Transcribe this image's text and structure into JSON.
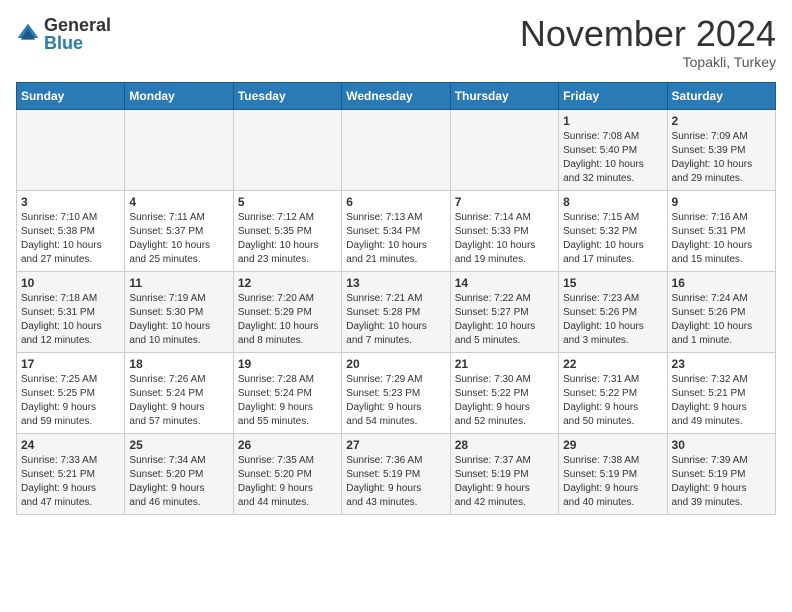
{
  "header": {
    "logo_general": "General",
    "logo_blue": "Blue",
    "month_title": "November 2024",
    "location": "Topakli, Turkey"
  },
  "weekdays": [
    "Sunday",
    "Monday",
    "Tuesday",
    "Wednesday",
    "Thursday",
    "Friday",
    "Saturday"
  ],
  "weeks": [
    [
      {
        "day": "",
        "info": ""
      },
      {
        "day": "",
        "info": ""
      },
      {
        "day": "",
        "info": ""
      },
      {
        "day": "",
        "info": ""
      },
      {
        "day": "",
        "info": ""
      },
      {
        "day": "1",
        "info": "Sunrise: 7:08 AM\nSunset: 5:40 PM\nDaylight: 10 hours\nand 32 minutes."
      },
      {
        "day": "2",
        "info": "Sunrise: 7:09 AM\nSunset: 5:39 PM\nDaylight: 10 hours\nand 29 minutes."
      }
    ],
    [
      {
        "day": "3",
        "info": "Sunrise: 7:10 AM\nSunset: 5:38 PM\nDaylight: 10 hours\nand 27 minutes."
      },
      {
        "day": "4",
        "info": "Sunrise: 7:11 AM\nSunset: 5:37 PM\nDaylight: 10 hours\nand 25 minutes."
      },
      {
        "day": "5",
        "info": "Sunrise: 7:12 AM\nSunset: 5:35 PM\nDaylight: 10 hours\nand 23 minutes."
      },
      {
        "day": "6",
        "info": "Sunrise: 7:13 AM\nSunset: 5:34 PM\nDaylight: 10 hours\nand 21 minutes."
      },
      {
        "day": "7",
        "info": "Sunrise: 7:14 AM\nSunset: 5:33 PM\nDaylight: 10 hours\nand 19 minutes."
      },
      {
        "day": "8",
        "info": "Sunrise: 7:15 AM\nSunset: 5:32 PM\nDaylight: 10 hours\nand 17 minutes."
      },
      {
        "day": "9",
        "info": "Sunrise: 7:16 AM\nSunset: 5:31 PM\nDaylight: 10 hours\nand 15 minutes."
      }
    ],
    [
      {
        "day": "10",
        "info": "Sunrise: 7:18 AM\nSunset: 5:31 PM\nDaylight: 10 hours\nand 12 minutes."
      },
      {
        "day": "11",
        "info": "Sunrise: 7:19 AM\nSunset: 5:30 PM\nDaylight: 10 hours\nand 10 minutes."
      },
      {
        "day": "12",
        "info": "Sunrise: 7:20 AM\nSunset: 5:29 PM\nDaylight: 10 hours\nand 8 minutes."
      },
      {
        "day": "13",
        "info": "Sunrise: 7:21 AM\nSunset: 5:28 PM\nDaylight: 10 hours\nand 7 minutes."
      },
      {
        "day": "14",
        "info": "Sunrise: 7:22 AM\nSunset: 5:27 PM\nDaylight: 10 hours\nand 5 minutes."
      },
      {
        "day": "15",
        "info": "Sunrise: 7:23 AM\nSunset: 5:26 PM\nDaylight: 10 hours\nand 3 minutes."
      },
      {
        "day": "16",
        "info": "Sunrise: 7:24 AM\nSunset: 5:26 PM\nDaylight: 10 hours\nand 1 minute."
      }
    ],
    [
      {
        "day": "17",
        "info": "Sunrise: 7:25 AM\nSunset: 5:25 PM\nDaylight: 9 hours\nand 59 minutes."
      },
      {
        "day": "18",
        "info": "Sunrise: 7:26 AM\nSunset: 5:24 PM\nDaylight: 9 hours\nand 57 minutes."
      },
      {
        "day": "19",
        "info": "Sunrise: 7:28 AM\nSunset: 5:24 PM\nDaylight: 9 hours\nand 55 minutes."
      },
      {
        "day": "20",
        "info": "Sunrise: 7:29 AM\nSunset: 5:23 PM\nDaylight: 9 hours\nand 54 minutes."
      },
      {
        "day": "21",
        "info": "Sunrise: 7:30 AM\nSunset: 5:22 PM\nDaylight: 9 hours\nand 52 minutes."
      },
      {
        "day": "22",
        "info": "Sunrise: 7:31 AM\nSunset: 5:22 PM\nDaylight: 9 hours\nand 50 minutes."
      },
      {
        "day": "23",
        "info": "Sunrise: 7:32 AM\nSunset: 5:21 PM\nDaylight: 9 hours\nand 49 minutes."
      }
    ],
    [
      {
        "day": "24",
        "info": "Sunrise: 7:33 AM\nSunset: 5:21 PM\nDaylight: 9 hours\nand 47 minutes."
      },
      {
        "day": "25",
        "info": "Sunrise: 7:34 AM\nSunset: 5:20 PM\nDaylight: 9 hours\nand 46 minutes."
      },
      {
        "day": "26",
        "info": "Sunrise: 7:35 AM\nSunset: 5:20 PM\nDaylight: 9 hours\nand 44 minutes."
      },
      {
        "day": "27",
        "info": "Sunrise: 7:36 AM\nSunset: 5:19 PM\nDaylight: 9 hours\nand 43 minutes."
      },
      {
        "day": "28",
        "info": "Sunrise: 7:37 AM\nSunset: 5:19 PM\nDaylight: 9 hours\nand 42 minutes."
      },
      {
        "day": "29",
        "info": "Sunrise: 7:38 AM\nSunset: 5:19 PM\nDaylight: 9 hours\nand 40 minutes."
      },
      {
        "day": "30",
        "info": "Sunrise: 7:39 AM\nSunset: 5:19 PM\nDaylight: 9 hours\nand 39 minutes."
      }
    ]
  ]
}
